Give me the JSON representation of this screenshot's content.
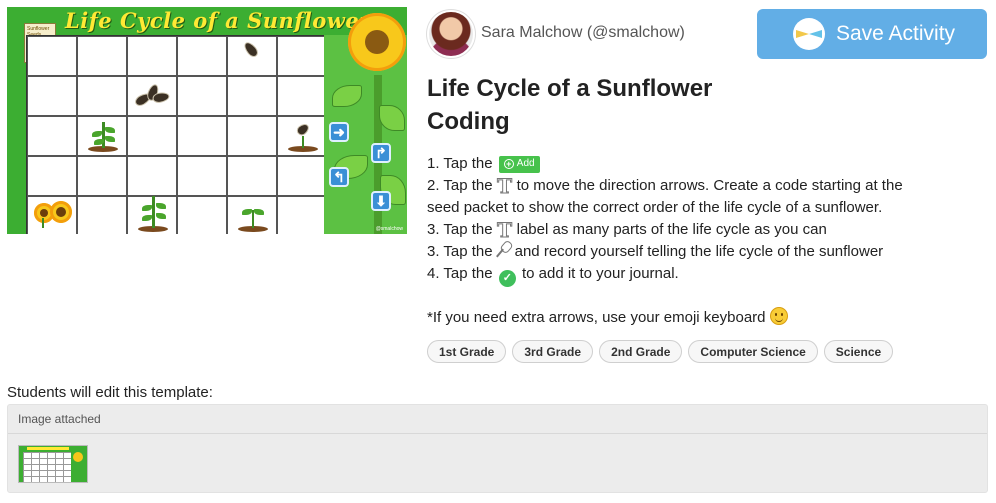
{
  "preview": {
    "title": "Life Cycle of a Sunflower",
    "packet_label": "Sunflower Seeds",
    "credit": "@smalchow",
    "arrows": [
      "right-arrow",
      "turn-right-arrow",
      "turn-left-arrow",
      "down-arrow"
    ]
  },
  "author": {
    "name": "Sara Malchow (@smalchow)"
  },
  "save_button": {
    "label": "Save Activity"
  },
  "activity": {
    "title_line1": "Life Cycle of a Sunflower",
    "title_line2": "Coding",
    "steps": {
      "s1_prefix": "1. Tap the",
      "add_chip": "Add",
      "s2_prefix": "2. Tap the",
      "s2_suffix": "to move the direction arrows. Create a code starting at the seed packet to show the correct order of the life cycle of a sunflower.",
      "s3a_prefix": "3. Tap the",
      "s3a_suffix": "label as many parts of the life cycle as you can",
      "s3b_prefix": "3. Tap the",
      "s3b_suffix": "and record yourself telling the life cycle of the sunflower",
      "s4_prefix": "4. Tap the",
      "s4_suffix": "to add it to your journal."
    },
    "note": "*If you need extra arrows, use your emoji keyboard"
  },
  "tags": [
    "1st Grade",
    "3rd Grade",
    "2nd Grade",
    "Computer Science",
    "Science"
  ],
  "template": {
    "label": "Students will edit this template:",
    "attachment_header": "Image attached"
  },
  "colors": {
    "save_button": "#62aee6",
    "preview_green": "#3cae32",
    "add_chip": "#47c24c",
    "check": "#3fbf5c"
  }
}
